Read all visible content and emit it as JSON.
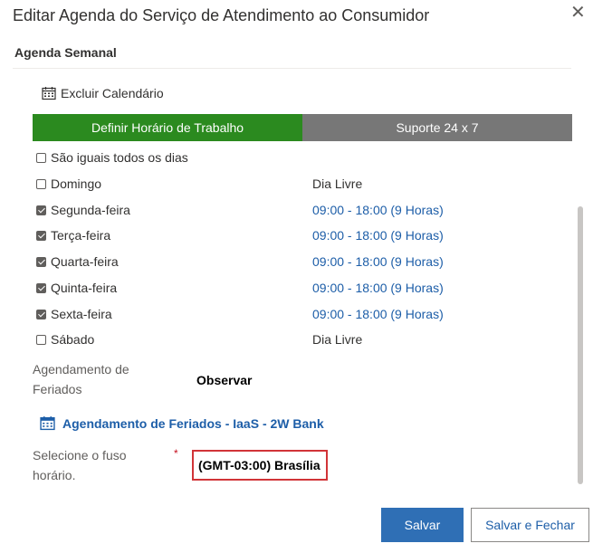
{
  "dialog": {
    "title": "Editar Agenda do Serviço de Atendimento ao Consumidor",
    "close_label": "✕"
  },
  "section_title": "Agenda Semanal",
  "exclude_calendar_label": "Excluir Calendário",
  "tabs": [
    {
      "label": "Definir Horário de Trabalho",
      "active": true
    },
    {
      "label": "Suporte 24 x 7",
      "active": false
    }
  ],
  "same_all_days": {
    "label": "São iguais todos os dias",
    "checked": false
  },
  "days": [
    {
      "label": "Domingo",
      "checked": false,
      "hours": "Dia Livre"
    },
    {
      "label": "Segunda-feira",
      "checked": true,
      "hours": "09:00 - 18:00 (9 Horas)"
    },
    {
      "label": "Terça-feira",
      "checked": true,
      "hours": "09:00 - 18:00 (9 Horas)"
    },
    {
      "label": "Quarta-feira",
      "checked": true,
      "hours": "09:00 - 18:00 (9 Horas)"
    },
    {
      "label": "Quinta-feira",
      "checked": true,
      "hours": "09:00 - 18:00 (9 Horas)"
    },
    {
      "label": "Sexta-feira",
      "checked": true,
      "hours": "09:00 - 18:00 (9 Horas)"
    },
    {
      "label": "Sábado",
      "checked": false,
      "hours": "Dia Livre"
    }
  ],
  "holiday_schedule": {
    "label": "Agendamento de Feriados",
    "value": "Observar",
    "link": "Agendamento de Feriados - IaaS - 2W Bank"
  },
  "timezone": {
    "label": "Selecione o fuso horário.",
    "required_mark": "*",
    "value": "(GMT-03:00) Brasília"
  },
  "buttons": {
    "save": "Salvar",
    "save_close": "Salvar e Fechar"
  },
  "colors": {
    "active_tab": "#2b8a1f",
    "inactive_tab": "#777777",
    "link": "#1d5ea8",
    "primary_button": "#2f6fb5",
    "highlight_border": "#d13438"
  }
}
